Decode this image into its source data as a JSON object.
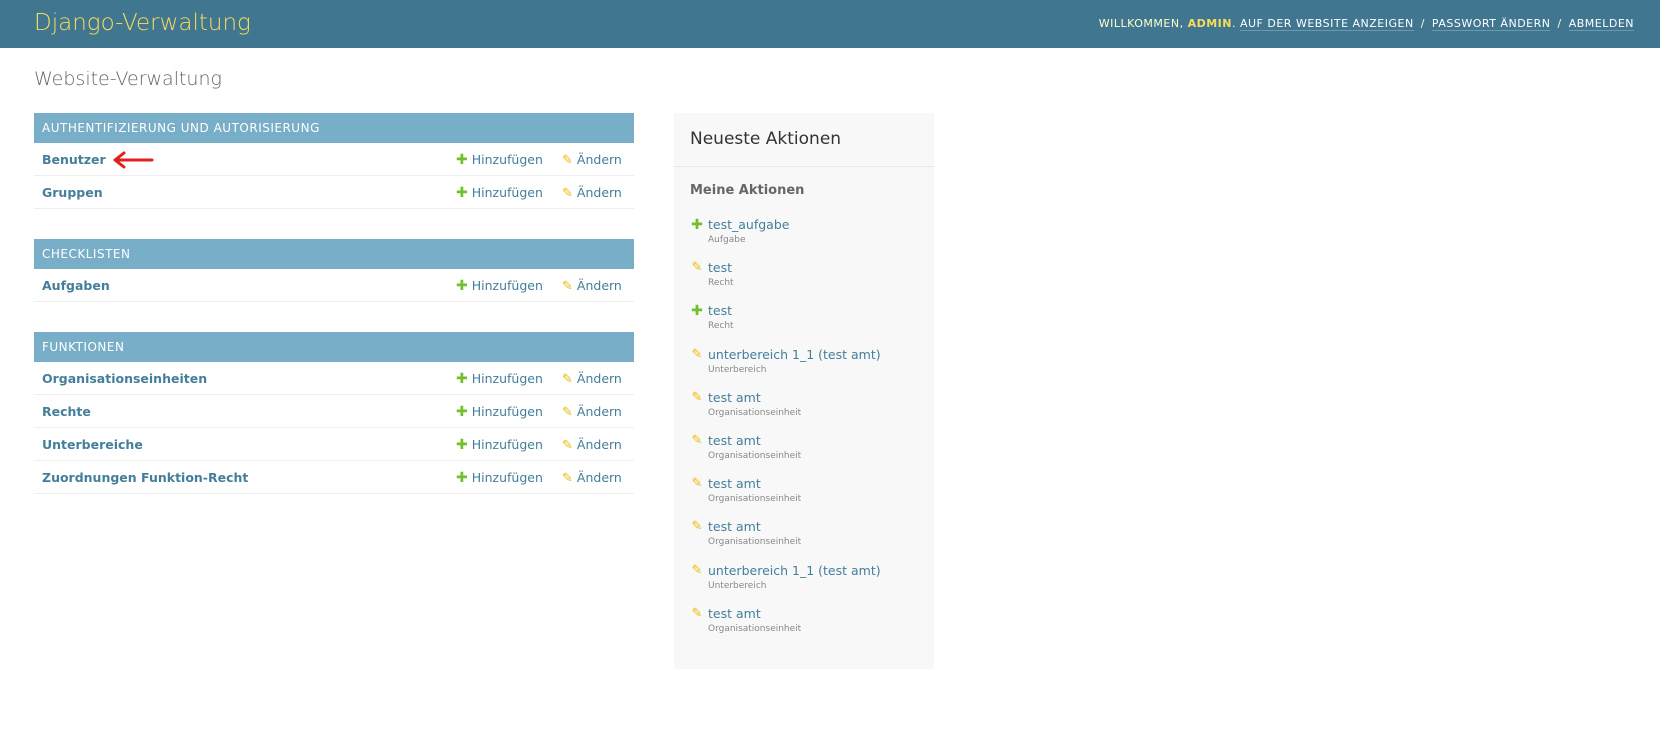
{
  "header": {
    "brand": "Django-Verwaltung",
    "welcome": "Willkommen,",
    "username": "admin",
    "links": [
      "Auf der Website anzeigen",
      "Passwort ändern",
      "Abmelden"
    ],
    "separator": "/"
  },
  "page": {
    "title": "Website-Verwaltung"
  },
  "add_label": "Hinzufügen",
  "change_label": "Ändern",
  "modules": [
    {
      "caption": "Authentifizierung und Autorisierung",
      "models": [
        "Benutzer",
        "Gruppen"
      ]
    },
    {
      "caption": "Checklisten",
      "models": [
        "Aufgaben"
      ]
    },
    {
      "caption": "Funktionen",
      "models": [
        "Organisationseinheiten",
        "Rechte",
        "Unterbereiche",
        "Zuordnungen Funktion-Recht"
      ]
    }
  ],
  "recent": {
    "title": "Neueste Aktionen",
    "subtitle": "Meine Aktionen",
    "actions": [
      {
        "icon": "plus-icon",
        "name": "test_aufgabe",
        "type": "Aufgabe"
      },
      {
        "icon": "pencil-icon",
        "name": "test",
        "type": "Recht"
      },
      {
        "icon": "plus-icon",
        "name": "test",
        "type": "Recht"
      },
      {
        "icon": "pencil-icon",
        "name": "unterbereich 1_1 (test amt)",
        "type": "Unterbereich"
      },
      {
        "icon": "pencil-icon",
        "name": "test amt",
        "type": "Organisationseinheit"
      },
      {
        "icon": "pencil-icon",
        "name": "test amt",
        "type": "Organisationseinheit"
      },
      {
        "icon": "pencil-icon",
        "name": "test amt",
        "type": "Organisationseinheit"
      },
      {
        "icon": "pencil-icon",
        "name": "test amt",
        "type": "Organisationseinheit"
      },
      {
        "icon": "pencil-icon",
        "name": "unterbereich 1_1 (test amt)",
        "type": "Unterbereich"
      },
      {
        "icon": "pencil-icon",
        "name": "test amt",
        "type": "Organisationseinheit"
      }
    ]
  },
  "colors": {
    "header_bg": "#417690",
    "brand": "#f5dd5d",
    "caption_bg": "#79aec8",
    "link": "#447e9b",
    "add_icon": "#70bf2b",
    "change_icon": "#efb80b",
    "annotation_arrow": "#e0201b"
  }
}
